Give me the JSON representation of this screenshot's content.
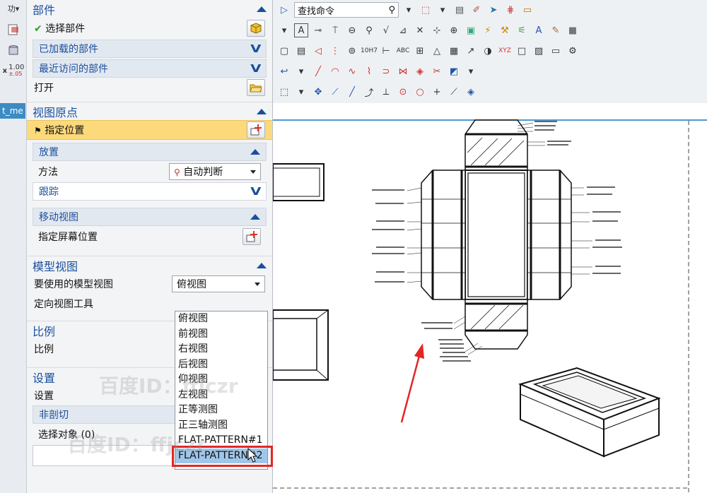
{
  "left_strip": {
    "r1": "功▾",
    "r3_x": "x",
    "r3_val": "1.00",
    "r3_tol": "±.05",
    "tab": "t_me"
  },
  "toolbar": {
    "command_search_placeholder": "查找命令"
  },
  "panel": {
    "parts": {
      "title": "部件",
      "select_part": "选择部件",
      "loaded_parts": "已加载的部件",
      "recent_parts": "最近访问的部件",
      "open": "打开"
    },
    "view_origin": {
      "title": "视图原点",
      "specify_location": "指定位置",
      "placement": "放置",
      "method_label": "方法",
      "method_value": "自动判断",
      "tracking": "跟踪",
      "move_view": "移动视图",
      "specify_screen_location": "指定屏幕位置"
    },
    "model_view": {
      "title": "模型视图",
      "model_view_label": "要使用的模型视图",
      "model_view_value": "俯视图",
      "orient_tool": "定向视图工具"
    },
    "scale": {
      "title": "比例",
      "label": "比例"
    },
    "settings": {
      "title": "设置",
      "label": "设置",
      "non_section": "非剖切",
      "select_objects": "选择对象 (0)"
    }
  },
  "dropdown_options": [
    "俯视图",
    "前视图",
    "右视图",
    "后视图",
    "仰视图",
    "左视图",
    "正等测图",
    "正三轴测图",
    "FLAT-PATTERN#1",
    "FLAT-PATTERN#2"
  ],
  "selected_option_index": 9,
  "watermark": {
    "text1": "百度ID：ffjczr",
    "text2": "百度ID：ffjczr"
  },
  "colors": {
    "accent_blue": "#1a4f9c",
    "highlight_yellow": "#fcd97a",
    "selection_blue": "#9fc6ea",
    "annotation_red": "#e32626"
  }
}
